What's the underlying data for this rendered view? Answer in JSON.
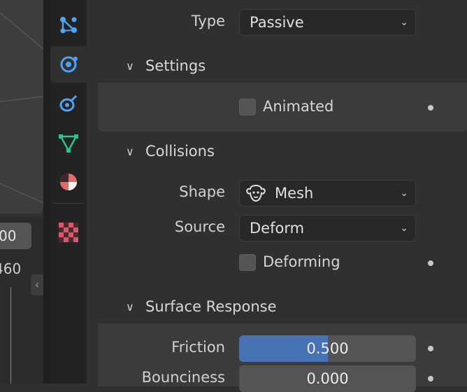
{
  "viewport": {
    "frame_current": "00",
    "frame_end": "460"
  },
  "tabs": [
    {
      "name": "particles-tab",
      "icon": "particles-icon",
      "color": "#4fa3f5"
    },
    {
      "name": "physics-tab",
      "icon": "physics-icon",
      "color": "#4fa3f5",
      "active": true
    },
    {
      "name": "constraints-tab",
      "icon": "object-constraint-icon",
      "color": "#4fa3f5"
    },
    {
      "name": "data-tab",
      "icon": "mesh-data-icon",
      "color": "#29c68a"
    },
    {
      "name": "material-tab",
      "icon": "material-icon",
      "color": "#e06b6b"
    },
    {
      "name": "texture-tab",
      "icon": "texture-icon",
      "color": "#d45a6a"
    }
  ],
  "rigid_body": {
    "type_label": "Type",
    "type_value": "Passive",
    "settings": {
      "header": "Settings",
      "animated_label": "Animated",
      "animated_checked": false
    },
    "collisions": {
      "header": "Collisions",
      "shape_label": "Shape",
      "shape_value": "Mesh",
      "shape_icon": "mesh-monkey-icon",
      "source_label": "Source",
      "source_value": "Deform",
      "deforming_label": "Deforming",
      "deforming_checked": false
    },
    "surface_response": {
      "header": "Surface Response",
      "friction_label": "Friction",
      "friction_value": "0.500",
      "friction_fraction": 0.5,
      "bounciness_label": "Bounciness",
      "bounciness_value": "0.000",
      "bounciness_fraction": 0.0
    }
  },
  "colors": {
    "accent": "#4772b3",
    "panel_bg": "#303030",
    "subpanel_bg": "#3b3b3b"
  }
}
